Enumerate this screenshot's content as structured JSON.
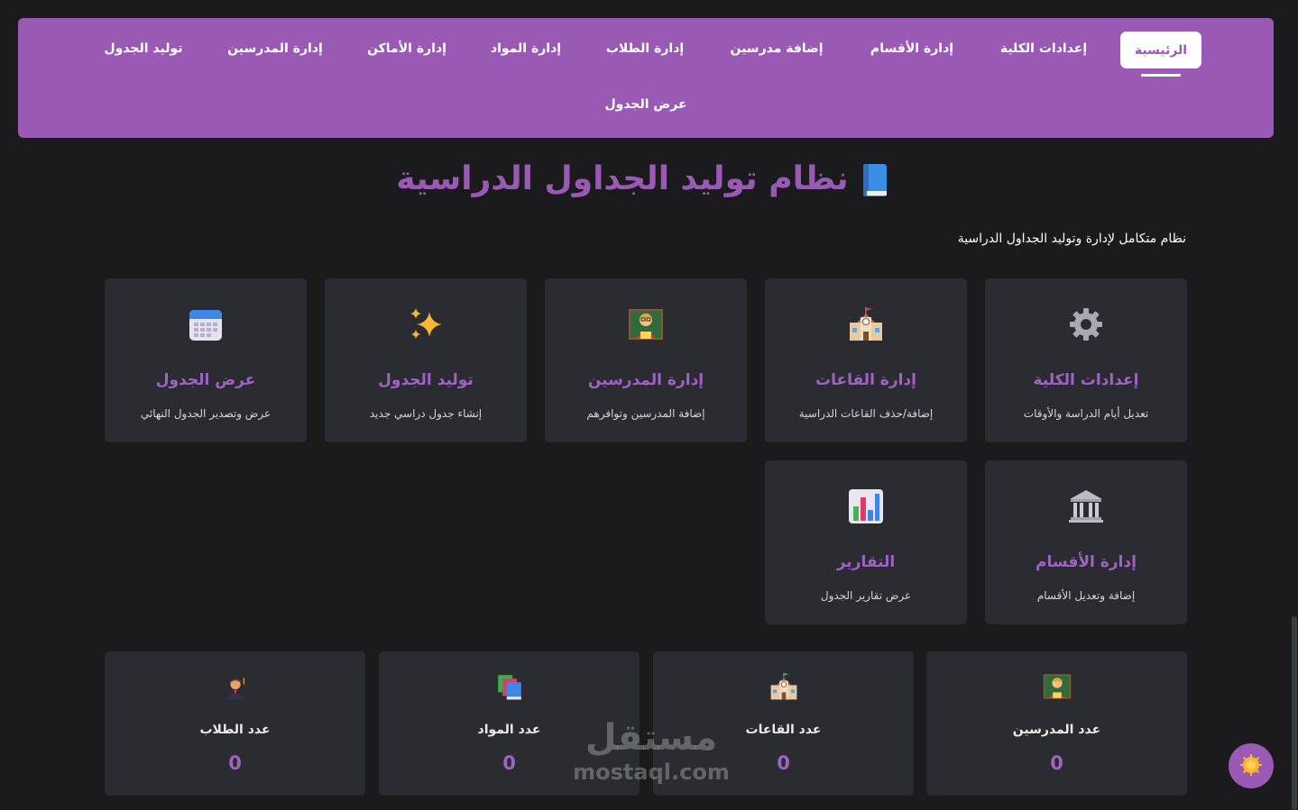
{
  "nav": {
    "active": "الرئيسية",
    "items": [
      "إعدادات الكلية",
      "إدارة الأقسام",
      "إضافة مدرسين",
      "إدارة الطلاب",
      "إدارة المواد",
      "إدارة الأماكن",
      "إدارة المدرسين",
      "توليد الجدول",
      "عرض الجدول"
    ]
  },
  "header": {
    "title": "نظام توليد الجداول الدراسية",
    "title_icon": "blue-book-icon",
    "subtitle": "نظام متكامل لإدارة وتوليد الجداول الدراسية"
  },
  "cards": [
    {
      "title": "إعدادات الكلية",
      "desc": "تعديل أيام الدراسة والأوقات",
      "icon": "gear-icon"
    },
    {
      "title": "إدارة القاعات",
      "desc": "إضافة/حذف القاعات الدراسية",
      "icon": "school-icon"
    },
    {
      "title": "إدارة المدرسين",
      "desc": "إضافة المدرسين وتوافرهم",
      "icon": "teacher-icon"
    },
    {
      "title": "توليد الجدول",
      "desc": "إنشاء جدول دراسي جديد",
      "icon": "sparkles-icon"
    },
    {
      "title": "عرض الجدول",
      "desc": "عرض وتصدير الجدول النهائي",
      "icon": "calendar-icon"
    },
    {
      "title": "إدارة الأقسام",
      "desc": "إضافة وتعديل الأقسام",
      "icon": "classical-building-icon"
    },
    {
      "title": "التقارير",
      "desc": "عرض تقارير الجدول",
      "icon": "bar-chart-icon"
    }
  ],
  "stats": [
    {
      "label": "عدد المدرسين",
      "value": "0",
      "icon": "teacher-icon"
    },
    {
      "label": "عدد القاعات",
      "value": "0",
      "icon": "school-icon"
    },
    {
      "label": "عدد المواد",
      "value": "0",
      "icon": "books-icon"
    },
    {
      "label": "عدد الطلاب",
      "value": "0",
      "icon": "student-icon"
    }
  ],
  "watermark": {
    "arabic": "مستقل",
    "latin": "mostaql.com"
  },
  "colors": {
    "accent": "#9b59b6",
    "background": "#1b1b1d",
    "card": "#2a2c31"
  }
}
